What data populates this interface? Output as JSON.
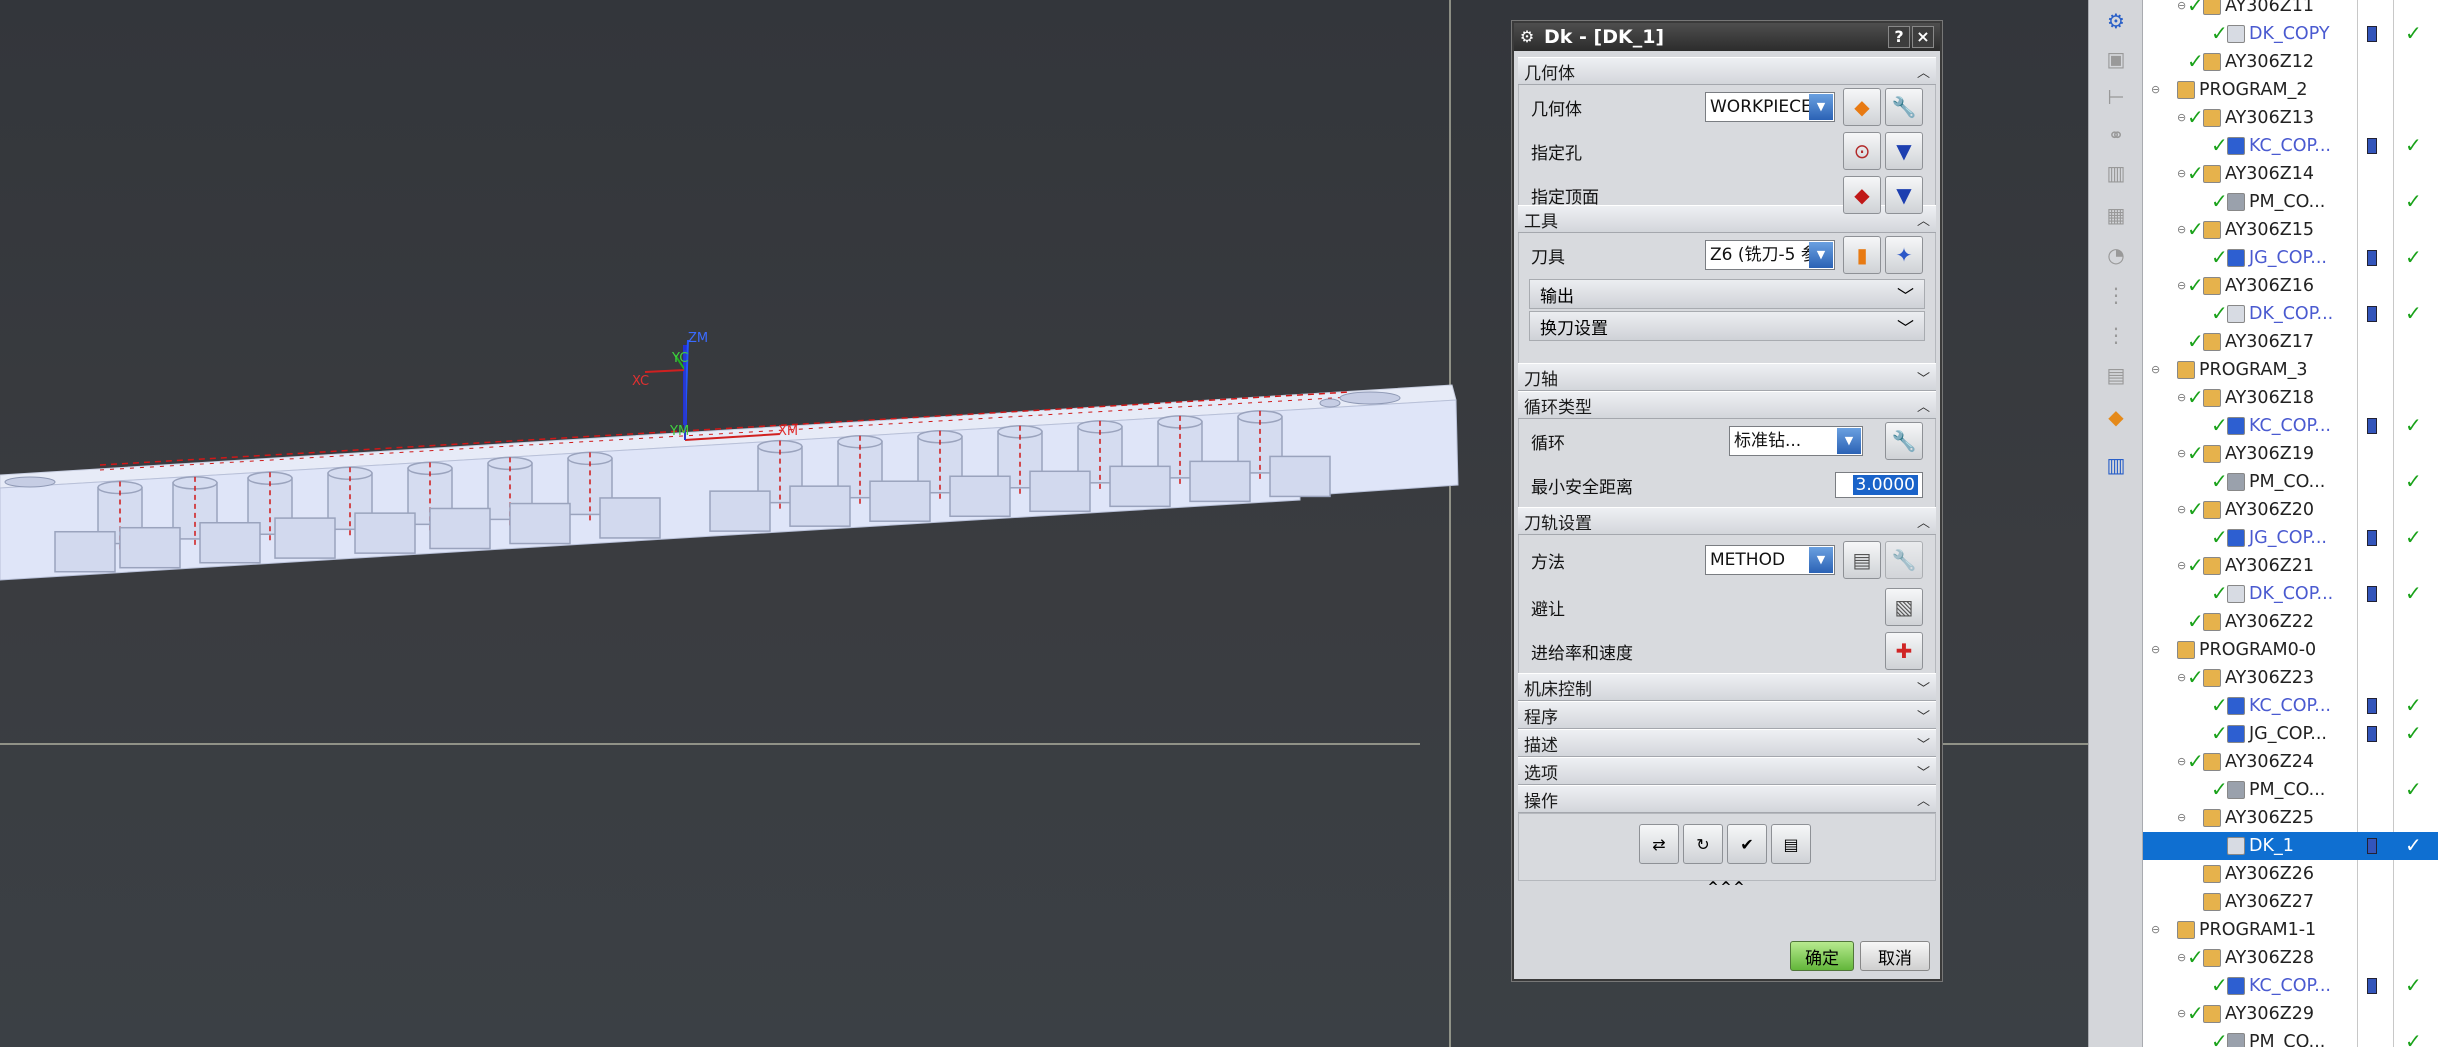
{
  "viewport": {
    "axis_labels": {
      "zm": "ZM",
      "yc": "YC",
      "xc": "XC",
      "ym": "YM",
      "xm": "XM"
    },
    "colors": {
      "background": "#35383c",
      "part": "#dde3f5",
      "crosshair": "#e8e8d0"
    }
  },
  "dialog": {
    "title": "Dk - [DK_1]",
    "help_label": "?",
    "close_label": "×",
    "sections": {
      "geometry": {
        "header": "几何体"
      },
      "tool": {
        "header": "工具"
      },
      "tool_axis": {
        "header": "刀轴"
      },
      "cycle_type": {
        "header": "循环类型"
      },
      "path_settings": {
        "header": "刀轨设置"
      },
      "machine_control": {
        "header": "机床控制"
      },
      "program": {
        "header": "程序"
      },
      "description": {
        "header": "描述"
      },
      "options": {
        "header": "选项"
      },
      "actions": {
        "header": "操作"
      }
    },
    "geometry": {
      "label": "几何体",
      "value": "WORKPIECE",
      "specify_hole_label": "指定孔",
      "specify_top_label": "指定顶面"
    },
    "tool": {
      "label": "刀具",
      "value": "Z6 (铣刀-5 参",
      "output_label": "输出",
      "tool_change_label": "换刀设置"
    },
    "cycle": {
      "label": "循环",
      "value": "标准钻...",
      "min_clearance_label": "最小安全距离",
      "min_clearance_value": "3.0000"
    },
    "path": {
      "method_label": "方法",
      "method_value": "METHOD",
      "avoid_label": "避让",
      "feeds_label": "进给率和速度"
    },
    "more_label": "^^^",
    "ok_label": "确定",
    "cancel_label": "取消"
  },
  "tree": {
    "rows": [
      {
        "label": "AY306Z11",
        "indent": 2,
        "check": true,
        "toggle": "⊖",
        "type": "op"
      },
      {
        "label": "DK_COPY",
        "indent": 3,
        "check": true,
        "type": "dk",
        "link": true,
        "cols": true
      },
      {
        "label": "AY306Z12",
        "indent": 2,
        "check": true,
        "type": "op"
      },
      {
        "label": "PROGRAM_2",
        "indent": 1,
        "check": false,
        "toggle": "⊖",
        "type": "prog"
      },
      {
        "label": "AY306Z13",
        "indent": 2,
        "check": true,
        "toggle": "⊖",
        "type": "op"
      },
      {
        "label": "KC_COP...",
        "indent": 3,
        "check": true,
        "type": "kc",
        "link": true,
        "cols": true
      },
      {
        "label": "AY306Z14",
        "indent": 2,
        "check": true,
        "toggle": "⊖",
        "type": "op"
      },
      {
        "label": "PM_CO...",
        "indent": 3,
        "check": true,
        "type": "pm",
        "link": false,
        "colsb": true
      },
      {
        "label": "AY306Z15",
        "indent": 2,
        "check": true,
        "toggle": "⊖",
        "type": "op"
      },
      {
        "label": "JG_COP...",
        "indent": 3,
        "check": true,
        "type": "jg",
        "link": true,
        "cols": true
      },
      {
        "label": "AY306Z16",
        "indent": 2,
        "check": true,
        "toggle": "⊖",
        "type": "op"
      },
      {
        "label": "DK_COP...",
        "indent": 3,
        "check": true,
        "type": "dk",
        "link": true,
        "cols": true
      },
      {
        "label": "AY306Z17",
        "indent": 2,
        "check": true,
        "type": "op"
      },
      {
        "label": "PROGRAM_3",
        "indent": 1,
        "check": false,
        "toggle": "⊖",
        "type": "prog"
      },
      {
        "label": "AY306Z18",
        "indent": 2,
        "check": true,
        "toggle": "⊖",
        "type": "op"
      },
      {
        "label": "KC_COP...",
        "indent": 3,
        "check": true,
        "type": "kc",
        "link": true,
        "cols": true
      },
      {
        "label": "AY306Z19",
        "indent": 2,
        "check": true,
        "toggle": "⊖",
        "type": "op"
      },
      {
        "label": "PM_CO...",
        "indent": 3,
        "check": true,
        "type": "pm",
        "link": false,
        "colsb": true
      },
      {
        "label": "AY306Z20",
        "indent": 2,
        "check": true,
        "toggle": "⊖",
        "type": "op"
      },
      {
        "label": "JG_COP...",
        "indent": 3,
        "check": true,
        "type": "jg",
        "link": true,
        "cols": true
      },
      {
        "label": "AY306Z21",
        "indent": 2,
        "check": true,
        "toggle": "⊖",
        "type": "op"
      },
      {
        "label": "DK_COP...",
        "indent": 3,
        "check": true,
        "type": "dk",
        "link": true,
        "cols": true
      },
      {
        "label": "AY306Z22",
        "indent": 2,
        "check": true,
        "type": "op"
      },
      {
        "label": "PROGRAM0-0",
        "indent": 1,
        "check": false,
        "toggle": "⊖",
        "type": "prog"
      },
      {
        "label": "AY306Z23",
        "indent": 2,
        "check": true,
        "toggle": "⊖",
        "type": "op"
      },
      {
        "label": "KC_COP...",
        "indent": 3,
        "check": true,
        "type": "kc",
        "link": true,
        "cols": true
      },
      {
        "label": "JG_COP...",
        "indent": 3,
        "check": true,
        "type": "jg",
        "link": false,
        "cols": true
      },
      {
        "label": "AY306Z24",
        "indent": 2,
        "check": true,
        "toggle": "⊖",
        "type": "op"
      },
      {
        "label": "PM_CO...",
        "indent": 3,
        "check": true,
        "type": "pm",
        "link": false,
        "colsb": true
      },
      {
        "label": "AY306Z25",
        "indent": 2,
        "check": false,
        "toggle": "⊖",
        "type": "op"
      },
      {
        "label": "DK_1",
        "indent": 3,
        "check": false,
        "type": "dk",
        "link": false,
        "cols": true,
        "selected": true
      },
      {
        "label": "AY306Z26",
        "indent": 2,
        "check": false,
        "type": "op"
      },
      {
        "label": "AY306Z27",
        "indent": 2,
        "check": false,
        "type": "op"
      },
      {
        "label": "PROGRAM1-1",
        "indent": 1,
        "check": false,
        "toggle": "⊖",
        "type": "prog"
      },
      {
        "label": "AY306Z28",
        "indent": 2,
        "check": true,
        "toggle": "⊖",
        "type": "op"
      },
      {
        "label": "KC_COP...",
        "indent": 3,
        "check": true,
        "type": "kc",
        "link": true,
        "cols": true
      },
      {
        "label": "AY306Z29",
        "indent": 2,
        "check": true,
        "toggle": "⊖",
        "type": "op"
      },
      {
        "label": "PM_CO...",
        "indent": 3,
        "check": true,
        "type": "pm",
        "link": false,
        "colsb": true
      }
    ]
  }
}
